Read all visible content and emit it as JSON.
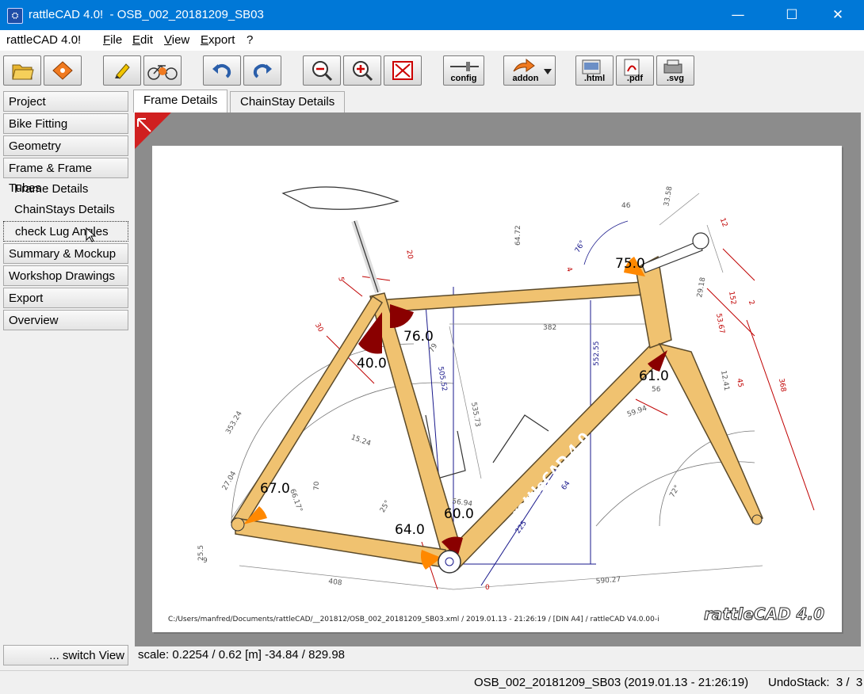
{
  "window": {
    "title": "rattleCAD 4.0!  - OSB_002_20181209_SB03",
    "icon_name": "rattlecad-app-icon",
    "minimize_glyph": "—",
    "maximize_glyph": "☐",
    "close_glyph": "✕"
  },
  "menubar": {
    "app_label": "rattleCAD 4.0!",
    "items": [
      {
        "label": "File",
        "mnemonic": "F",
        "rest": "ile"
      },
      {
        "label": "Edit",
        "mnemonic": "E",
        "rest": "dit"
      },
      {
        "label": "View",
        "mnemonic": "V",
        "rest": "iew"
      },
      {
        "label": "Export",
        "mnemonic": "E",
        "rest": "xport"
      },
      {
        "label": "?",
        "mnemonic": "",
        "rest": "?"
      }
    ]
  },
  "toolbar": {
    "config_label": "config",
    "addon_label": "addon",
    "html_label": ".html",
    "pdf_label": ".pdf",
    "svg_label": ".svg"
  },
  "sidebar": {
    "items": [
      {
        "label": "Project"
      },
      {
        "label": "Bike Fitting"
      },
      {
        "label": "Geometry"
      },
      {
        "label": "Frame & Frame Tubes"
      }
    ],
    "subitems": [
      {
        "label": "Frame Details"
      },
      {
        "label": "ChainStays Details"
      },
      {
        "label": "check Lug Angles"
      }
    ],
    "items2": [
      {
        "label": "Summary & Mockup"
      },
      {
        "label": "Workshop Drawings"
      },
      {
        "label": "Export"
      },
      {
        "label": "Overview"
      }
    ],
    "switch_label": "... switch View"
  },
  "tabs": [
    {
      "label": "Frame Details",
      "active": true
    },
    {
      "label": "ChainStay Details",
      "active": false
    }
  ],
  "drawing": {
    "angles": {
      "head": "75.0",
      "seat": "76.0",
      "seat_top": "40.0",
      "fork": "61.0",
      "stay": "67.0",
      "bb_left": "64.0",
      "bb_right": "60.0"
    },
    "dims": [
      "382",
      "552.55",
      "505.52",
      "535.73",
      "353.24",
      "27.04",
      "66.17°",
      "70",
      "15.24",
      "408",
      "590.27",
      "225",
      "64",
      "56.94",
      "46",
      "33.58",
      "29.18",
      "53.67",
      "152",
      "368",
      "12.41",
      "45",
      "59.94",
      "56",
      "25.5",
      "9",
      "64.72",
      "76°",
      "72°",
      "20",
      "5",
      "30",
      "12",
      "2",
      "4",
      "0",
      "25°",
      "79"
    ],
    "watermark": "rattleCAD 4.0",
    "downtube_text": "rattleCAD 4.0",
    "footer": "C:/Users/manfred/Documents/rattleCAD/__201812/OSB_002_20181209_SB03.xml   /   2019.01.13 - 21:26:19   /  [DIN A4]  /  rattleCAD   V4.0.00-i"
  },
  "status": {
    "scale_line": "scale: 0.2254 / 0.62  [m]  -34.84 / 829.98",
    "project": "OSB_002_20181209_SB03 (2019.01.13 - 21:26:19)",
    "undo": "UndoStack:  3 /  3"
  },
  "colors": {
    "titlebar": "#0078d7",
    "tube": "#f0c270",
    "tube_stroke": "#5b4a2a",
    "angle_orange": "#ff8800",
    "angle_dark": "#8a0000",
    "dim_red": "#c00000",
    "dim_blue": "#1a1a8c",
    "dim_gray": "#777777"
  }
}
